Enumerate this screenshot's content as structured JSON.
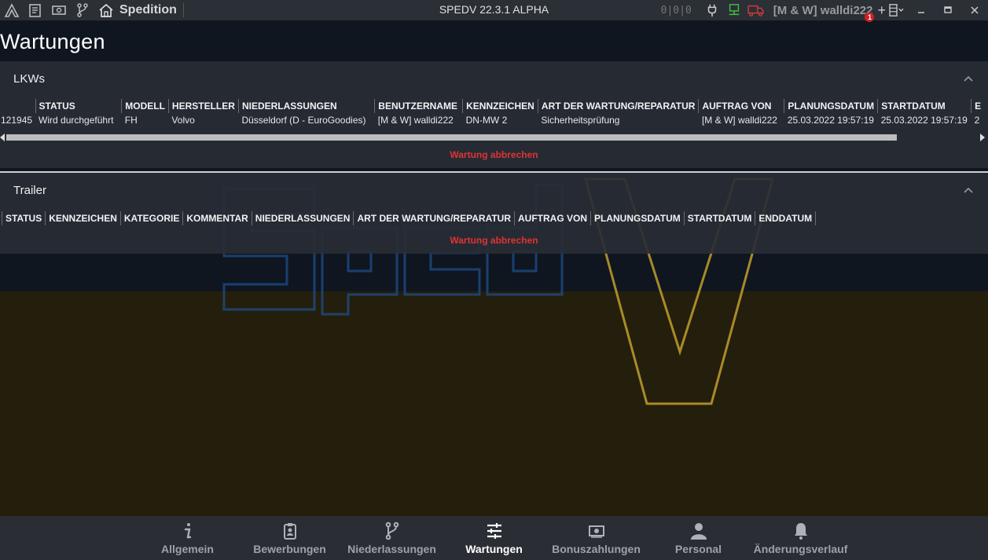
{
  "titlebar": {
    "app_section": "Spedition",
    "window_title": "SPEDV 22.3.1 ALPHA",
    "counter": "0|0|0",
    "user": "[M & W] walldi222",
    "notification_count": "1",
    "plus": "+"
  },
  "page": {
    "title": "Wartungen"
  },
  "lkw_panel": {
    "title": "LKWs",
    "columns": [
      "STATUS",
      "MODELL",
      "HERSTELLER",
      "NIEDERLASSUNGEN",
      "BENUTZERNAME",
      "KENNZEICHEN",
      "ART DER WARTUNG/REPARATUR",
      "AUFTRAG VON",
      "PLANUNGSDATUM",
      "STARTDATUM",
      "E"
    ],
    "rows": [
      {
        "id": "121945",
        "status": "Wird durchgeführt",
        "modell": "FH",
        "hersteller": "Volvo",
        "niederlassung": "Düsseldorf (D - EuroGoodies)",
        "benutzername": "[M & W] walldi222",
        "kennzeichen": "DN-MW 2",
        "art": "Sicherheitsprüfung",
        "auftrag_von": "[M & W] walldi222",
        "planungsdatum": "25.03.2022 19:57:19",
        "startdatum": "25.03.2022 19:57:19",
        "enddatum": "2"
      }
    ],
    "cancel_label": "Wartung abbrechen"
  },
  "trailer_panel": {
    "title": "Trailer",
    "columns": [
      "STATUS",
      "KENNZEICHEN",
      "KATEGORIE",
      "KOMMENTAR",
      "NIEDERLASSUNGEN",
      "ART DER WARTUNG/REPARATUR",
      "AUFTRAG VON",
      "PLANUNGSDATUM",
      "STARTDATUM",
      "ENDDATUM"
    ],
    "cancel_label": "Wartung abbrechen"
  },
  "bottom_nav": {
    "items": [
      {
        "label": "Allgemein",
        "icon": "info-icon"
      },
      {
        "label": "Bewerbungen",
        "icon": "id-badge-icon"
      },
      {
        "label": "Niederlassungen",
        "icon": "branch-icon"
      },
      {
        "label": "Wartungen",
        "icon": "sliders-icon"
      },
      {
        "label": "Bonuszahlungen",
        "icon": "money-icon"
      },
      {
        "label": "Personal",
        "icon": "person-icon"
      },
      {
        "label": "Änderungsverlauf",
        "icon": "bell-icon"
      }
    ],
    "active": "Wartungen"
  },
  "colors": {
    "accent_red": "#e03434",
    "watermark_blue": "#1e4f8a",
    "watermark_gold": "#b8972a"
  }
}
